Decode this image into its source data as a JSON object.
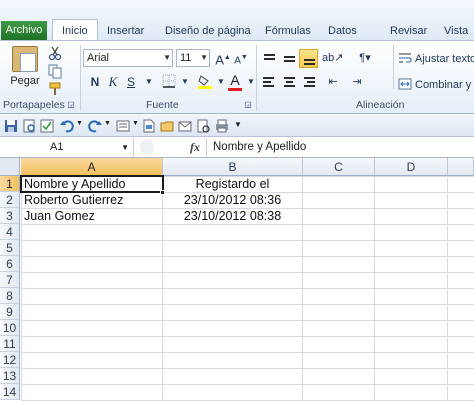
{
  "ribbon": {
    "tabs": [
      {
        "label": "Archivo",
        "kind": "file"
      },
      {
        "label": "Inicio",
        "kind": "active"
      },
      {
        "label": "Insertar",
        "kind": "tab"
      },
      {
        "label": "Diseño de página",
        "kind": "tab"
      },
      {
        "label": "Fórmulas",
        "kind": "tab"
      },
      {
        "label": "Datos",
        "kind": "tab"
      },
      {
        "label": "Revisar",
        "kind": "tab"
      },
      {
        "label": "Vista",
        "kind": "tab"
      }
    ],
    "clipboard": {
      "paste_label": "Pegar",
      "group_label": "Portapapeles"
    },
    "font": {
      "name": "Arial",
      "size": "11",
      "bold": "N",
      "italic": "K",
      "underline": "S",
      "font_color_glyph": "A",
      "grow_glyph": "A",
      "shrink_glyph": "A",
      "group_label": "Fuente"
    },
    "alignment": {
      "wrap_label": "Ajustar texto",
      "merge_label": "Combinar y c",
      "group_label": "Alineación"
    }
  },
  "formula_bar": {
    "cell_ref": "A1",
    "fx": "fx",
    "value": "Nombre y Apellido"
  },
  "sheet": {
    "columns": [
      "A",
      "B",
      "C",
      "D"
    ],
    "rows": [
      "1",
      "2",
      "3",
      "4",
      "5",
      "6",
      "7",
      "8",
      "9",
      "10",
      "11",
      "12",
      "13",
      "14"
    ],
    "cells": {
      "r1": {
        "a": "Nombre y Apellido",
        "b": "Registardo el"
      },
      "r2": {
        "a": "Roberto Gutierrez",
        "b": "23/10/2012 08:36"
      },
      "r3": {
        "a": "Juan Gomez",
        "b": "23/10/2012 08:38"
      }
    }
  },
  "colors": {
    "file_tab": "#1e7326",
    "selection_header": "#f1c15f",
    "ribbon_border": "#b2c3d7"
  }
}
